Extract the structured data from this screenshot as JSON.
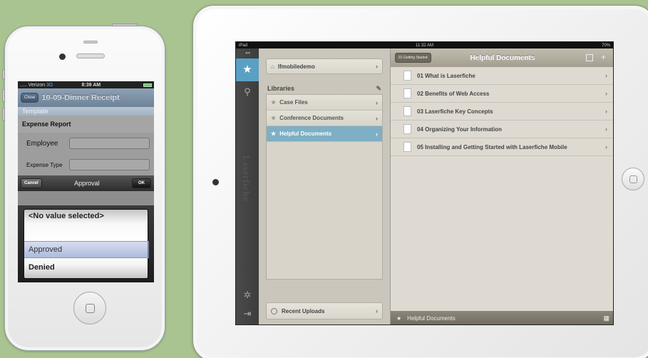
{
  "iphone": {
    "status": {
      "carrier": "..... Verizon",
      "network": "3G",
      "time": "8:39 AM"
    },
    "nav": {
      "close_label": "Close",
      "title": "10-09-Dinner Receipt"
    },
    "template_label": "Template",
    "section_title": "Expense Report",
    "fields": [
      {
        "label": "Employee",
        "value": ""
      },
      {
        "label": "Expense Type",
        "value": ""
      }
    ],
    "picker_toolbar": {
      "cancel_label": "Cancel",
      "title": "Approval",
      "ok_label": "OK"
    },
    "picker_options": [
      "<No value selected>",
      "Approved",
      "Denied"
    ],
    "picker_selected": "Approved"
  },
  "ipad": {
    "status": {
      "device": "iPad",
      "time": "11:32 AM",
      "battery": "70%"
    },
    "rail": {
      "collapse": "◂◂",
      "brand": "Laserfiche"
    },
    "left": {
      "repository": "lfmobiledemo",
      "libraries_title": "Libraries",
      "libraries": [
        "Case Files",
        "Conference Documents",
        "Helpful Documents"
      ],
      "active_library": "Helpful Documents",
      "recent": "Recent Uploads"
    },
    "right": {
      "back_label": "01 Getting Started",
      "title": "Helpful Documents",
      "documents": [
        "01 What is Laserfiche",
        "02 Benefits of Web Access",
        "03 Laserfiche Key Concepts",
        "04 Organizing Your Information",
        "05 Installing and Getting Started with Laserfiche Mobile"
      ],
      "footer": "Helpful Documents"
    }
  }
}
